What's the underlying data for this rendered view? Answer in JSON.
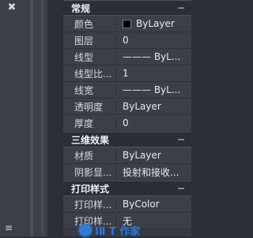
{
  "left": {
    "close_icon": "✖",
    "bottom_icon": "≡"
  },
  "sections": {
    "general": {
      "title": "常规",
      "collapse": "−",
      "rows": [
        {
          "label": "颜色",
          "value": "ByLayer"
        },
        {
          "label": "图层",
          "value": "0"
        },
        {
          "label": "线型",
          "value": "——— ByL..."
        },
        {
          "label": "线型比...",
          "value": "1"
        },
        {
          "label": "线宽",
          "value": "——— ByL..."
        },
        {
          "label": "透明度",
          "value": "ByLayer"
        },
        {
          "label": "厚度",
          "value": "0"
        }
      ]
    },
    "three_d": {
      "title": "三维效果",
      "collapse": "−",
      "rows": [
        {
          "label": "材质",
          "value": "ByLayer"
        },
        {
          "label": "阴影显...",
          "value": "投射和接收..."
        }
      ]
    },
    "plot_style": {
      "title": "打印样式",
      "collapse": "−",
      "rows": [
        {
          "label": "打印样...",
          "value": "ByColor"
        },
        {
          "label": "打印样...",
          "value": "无"
        }
      ]
    }
  },
  "colors": {
    "swatch": "#000000",
    "accent_red": "#c8262e"
  },
  "watermark": {
    "text": "ⅠⅡ T 作家"
  }
}
